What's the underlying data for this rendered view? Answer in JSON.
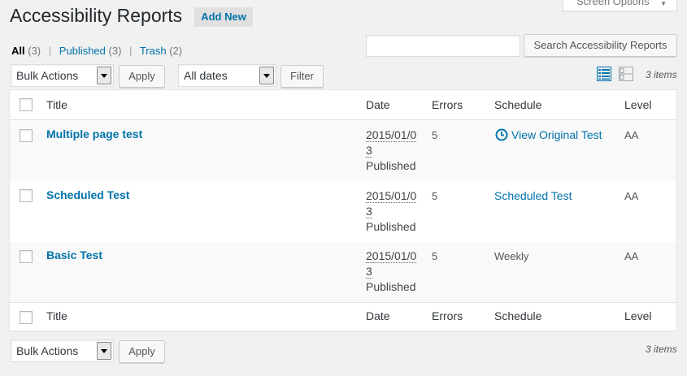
{
  "screen_options": {
    "label": "Screen Options"
  },
  "page_title": "Accessibility Reports",
  "add_new_label": "Add New",
  "filters": [
    {
      "label": "All",
      "count": "(3)"
    },
    {
      "label": "Published",
      "count": "(3)"
    },
    {
      "label": "Trash",
      "count": "(2)"
    }
  ],
  "search": {
    "value": "",
    "button_label": "Search Accessibility Reports"
  },
  "top_nav": {
    "bulk_actions": "Bulk Actions",
    "apply": "Apply",
    "dates": "All dates",
    "filter": "Filter",
    "items_count": "3 items"
  },
  "bottom_nav": {
    "bulk_actions": "Bulk Actions",
    "apply": "Apply",
    "items_count": "3 items"
  },
  "columns": {
    "title": "Title",
    "date": "Date",
    "errors": "Errors",
    "schedule": "Schedule",
    "level": "Level"
  },
  "rows": [
    {
      "title": "Multiple page test",
      "date_line1": "2015/01/0",
      "date_line2": "3",
      "status": "Published",
      "errors": "5",
      "schedule": "View Original Test",
      "level": "AA"
    },
    {
      "title": "Scheduled Test",
      "date_line1": "2015/01/0",
      "date_line2": "3",
      "status": "Published",
      "errors": "5",
      "schedule": "Scheduled Test",
      "level": "AA"
    },
    {
      "title": "Basic Test",
      "date_line1": "2015/01/0",
      "date_line2": "3",
      "status": "Published",
      "errors": "5",
      "schedule": "Weekly",
      "level": "AA"
    }
  ],
  "colors": {
    "link": "#0073aa",
    "active_view_icon": "#0073aa",
    "inactive_view_icon": "#a0a5aa"
  }
}
